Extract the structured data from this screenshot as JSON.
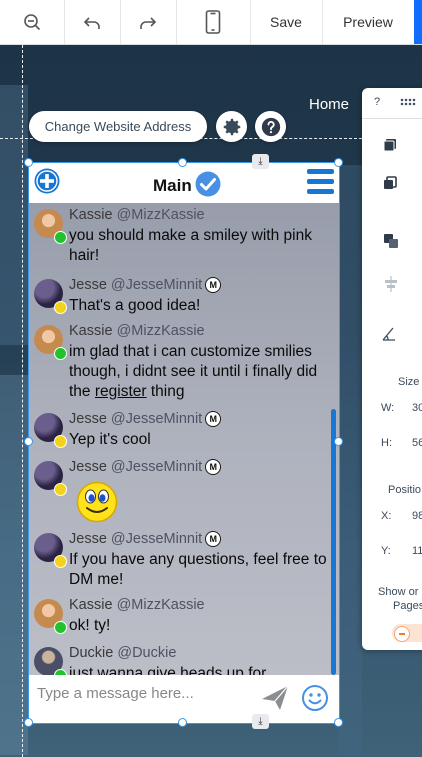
{
  "toolbar": {
    "zoom_out_icon": "zoom-out-icon",
    "undo_icon": "undo-icon",
    "redo_icon": "redo-icon",
    "mobile_icon": "mobile-icon",
    "save_label": "Save",
    "preview_label": "Preview",
    "accent_color": "#116dff"
  },
  "site": {
    "nav_home": "Home",
    "change_address_label": "Change Website Address"
  },
  "right_panel": {
    "header_icons": [
      "help-icon",
      "grid-icon"
    ],
    "tool_icons": [
      "layers-icon",
      "copy-icon",
      "arrange-icon",
      "align-icon",
      "rotate-icon"
    ],
    "size_label": "Size",
    "w_label": "W:",
    "w_value": "30",
    "h_label": "H:",
    "h_value": "56",
    "position_label": "Positio",
    "x_label": "X:",
    "x_value": "98",
    "y_label": "Y:",
    "y_value": "11",
    "show_on_label_1": "Show or",
    "show_on_label_2": "Pages"
  },
  "chat": {
    "title": "Main",
    "messages": [
      {
        "name": "Kassie",
        "handle": "@MizzKassie",
        "status": "online",
        "text": "you should make a smiley with pink hair!"
      },
      {
        "name": "Jesse",
        "handle": "@JesseMinnit",
        "moderator": "M",
        "status": "away",
        "text": "That's a good idea!"
      },
      {
        "name": "Kassie",
        "handle": "@MizzKassie",
        "status": "online",
        "text_before": "im glad that i can customize smilies though, i didnt see it until i finally did the ",
        "text_link": "register",
        "text_after": " thing"
      },
      {
        "name": "Jesse",
        "handle": "@JesseMinnit",
        "moderator": "M",
        "status": "away",
        "text": "Yep it's cool"
      },
      {
        "name": "Jesse",
        "handle": "@JesseMinnit",
        "moderator": "M",
        "status": "away",
        "text": ""
      },
      {
        "name": "Jesse",
        "handle": "@JesseMinnit",
        "moderator": "M",
        "status": "away",
        "text": "If you have any questions, feel free to DM me!"
      },
      {
        "name": "Kassie",
        "handle": "@MizzKassie",
        "status": "online",
        "text": "ok! ty!"
      },
      {
        "name": "Duckie",
        "handle": "@Duckie",
        "status": "online",
        "text": "just wanna give heads up for"
      }
    ],
    "composer_placeholder": "Type a message here...",
    "status_colors": {
      "online": "#22c22e",
      "away": "#f2d21b"
    },
    "accent_color": "#1976d2"
  }
}
